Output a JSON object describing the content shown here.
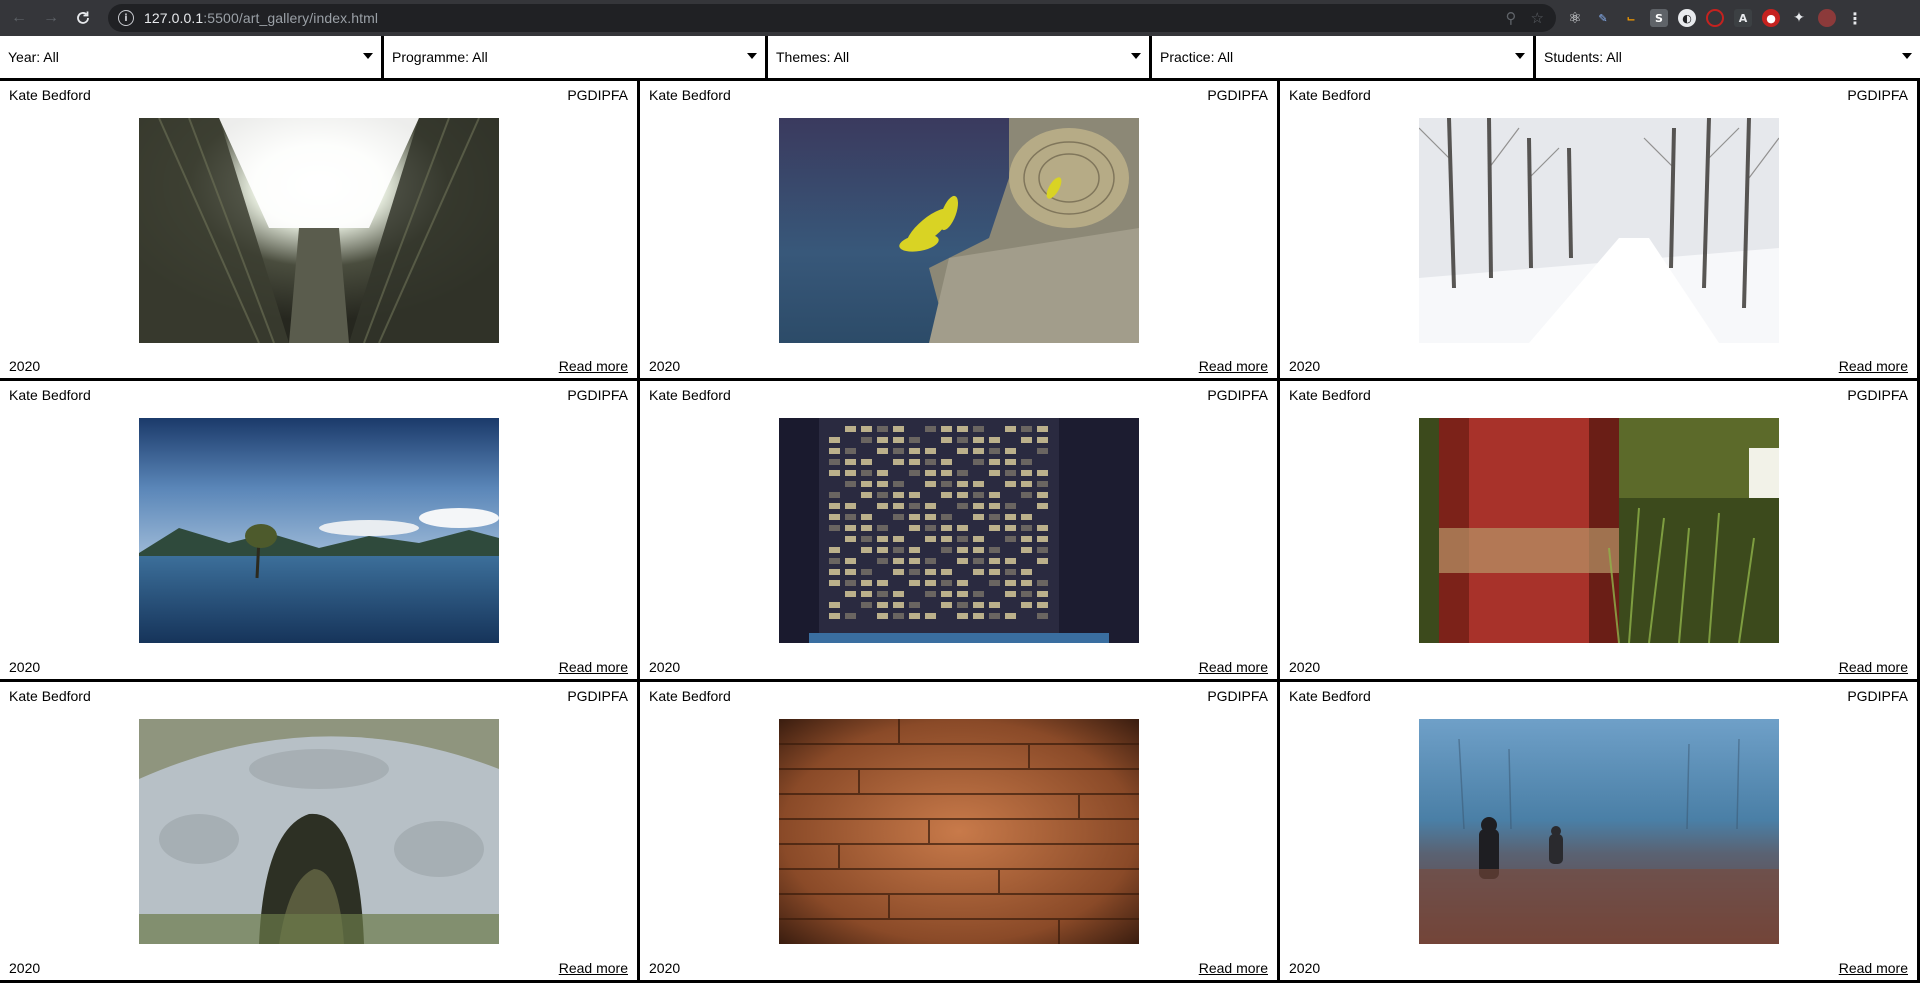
{
  "browser": {
    "url_host": "127.0.0.1",
    "url_rest": ":5500/art_gallery/index.html"
  },
  "filters": [
    {
      "label": "Year: All"
    },
    {
      "label": "Programme: All"
    },
    {
      "label": "Themes: All"
    },
    {
      "label": "Practice: All"
    },
    {
      "label": "Students: All"
    }
  ],
  "cards": [
    {
      "student": "Kate Bedford",
      "programme": "PGDIPFA",
      "year": "2020",
      "link": "Read more",
      "image": "building-courtyard-photo"
    },
    {
      "student": "Kate Bedford",
      "programme": "PGDIPFA",
      "year": "2020",
      "link": "Read more",
      "image": "plant-on-log-photo"
    },
    {
      "student": "Kate Bedford",
      "programme": "PGDIPFA",
      "year": "2020",
      "link": "Read more",
      "image": "snowy-road-photo"
    },
    {
      "student": "Kate Bedford",
      "programme": "PGDIPFA",
      "year": "2020",
      "link": "Read more",
      "image": "lake-tree-photo"
    },
    {
      "student": "Kate Bedford",
      "programme": "PGDIPFA",
      "year": "2020",
      "link": "Read more",
      "image": "skyscraper-night-photo"
    },
    {
      "student": "Kate Bedford",
      "programme": "PGDIPFA",
      "year": "2020",
      "link": "Read more",
      "image": "rusty-barrel-photo"
    },
    {
      "student": "Kate Bedford",
      "programme": "PGDIPFA",
      "year": "2020",
      "link": "Read more",
      "image": "rock-arch-photo"
    },
    {
      "student": "Kate Bedford",
      "programme": "PGDIPFA",
      "year": "2020",
      "link": "Read more",
      "image": "wood-planks-photo"
    },
    {
      "student": "Kate Bedford",
      "programme": "PGDIPFA",
      "year": "2020",
      "link": "Read more",
      "image": "foggy-field-photo"
    }
  ]
}
